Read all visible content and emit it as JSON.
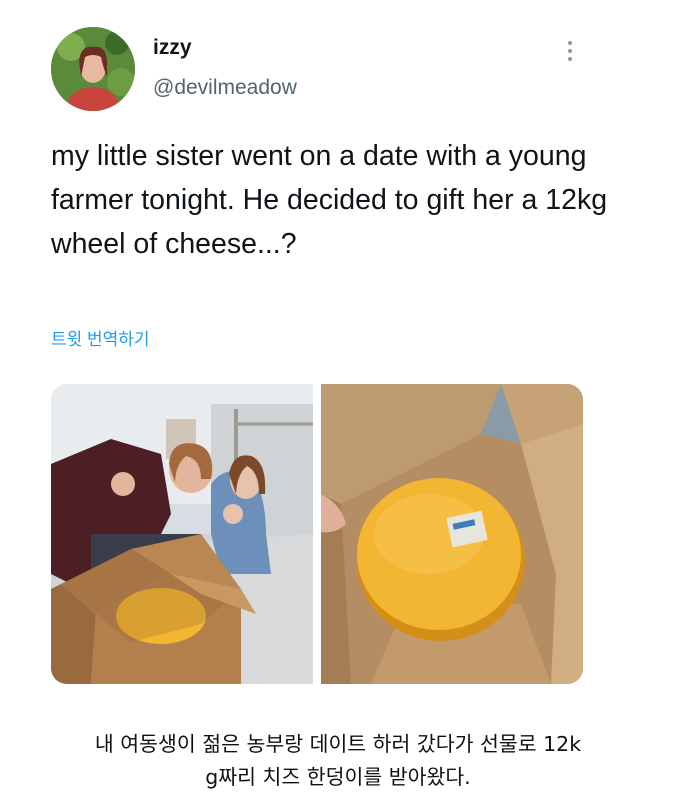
{
  "tweet": {
    "author_name": "izzy",
    "author_handle": "@devilmeadow",
    "text": "my little sister went on a date with a young farmer tonight. He decided to gift her a 12kg wheel of cheese...?",
    "translate_label": "트윗 번역하기",
    "more_icon": "more-options-icon",
    "media": [
      {
        "alt": "two girls with an open cardboard box containing a cheese wheel"
      },
      {
        "alt": "large yellow cheese wheel inside a cardboard box"
      }
    ]
  },
  "caption": {
    "line1": "내 여동생이 젊은 농부랑 데이트 하러 갔다가 선물로 12k",
    "line2": "g짜리 치즈 한덩이를 받아왔다."
  },
  "colors": {
    "handle": "#536471",
    "link": "#1d9bf0",
    "cheese": "#f2b632",
    "cardboard": "#b07d4f"
  }
}
